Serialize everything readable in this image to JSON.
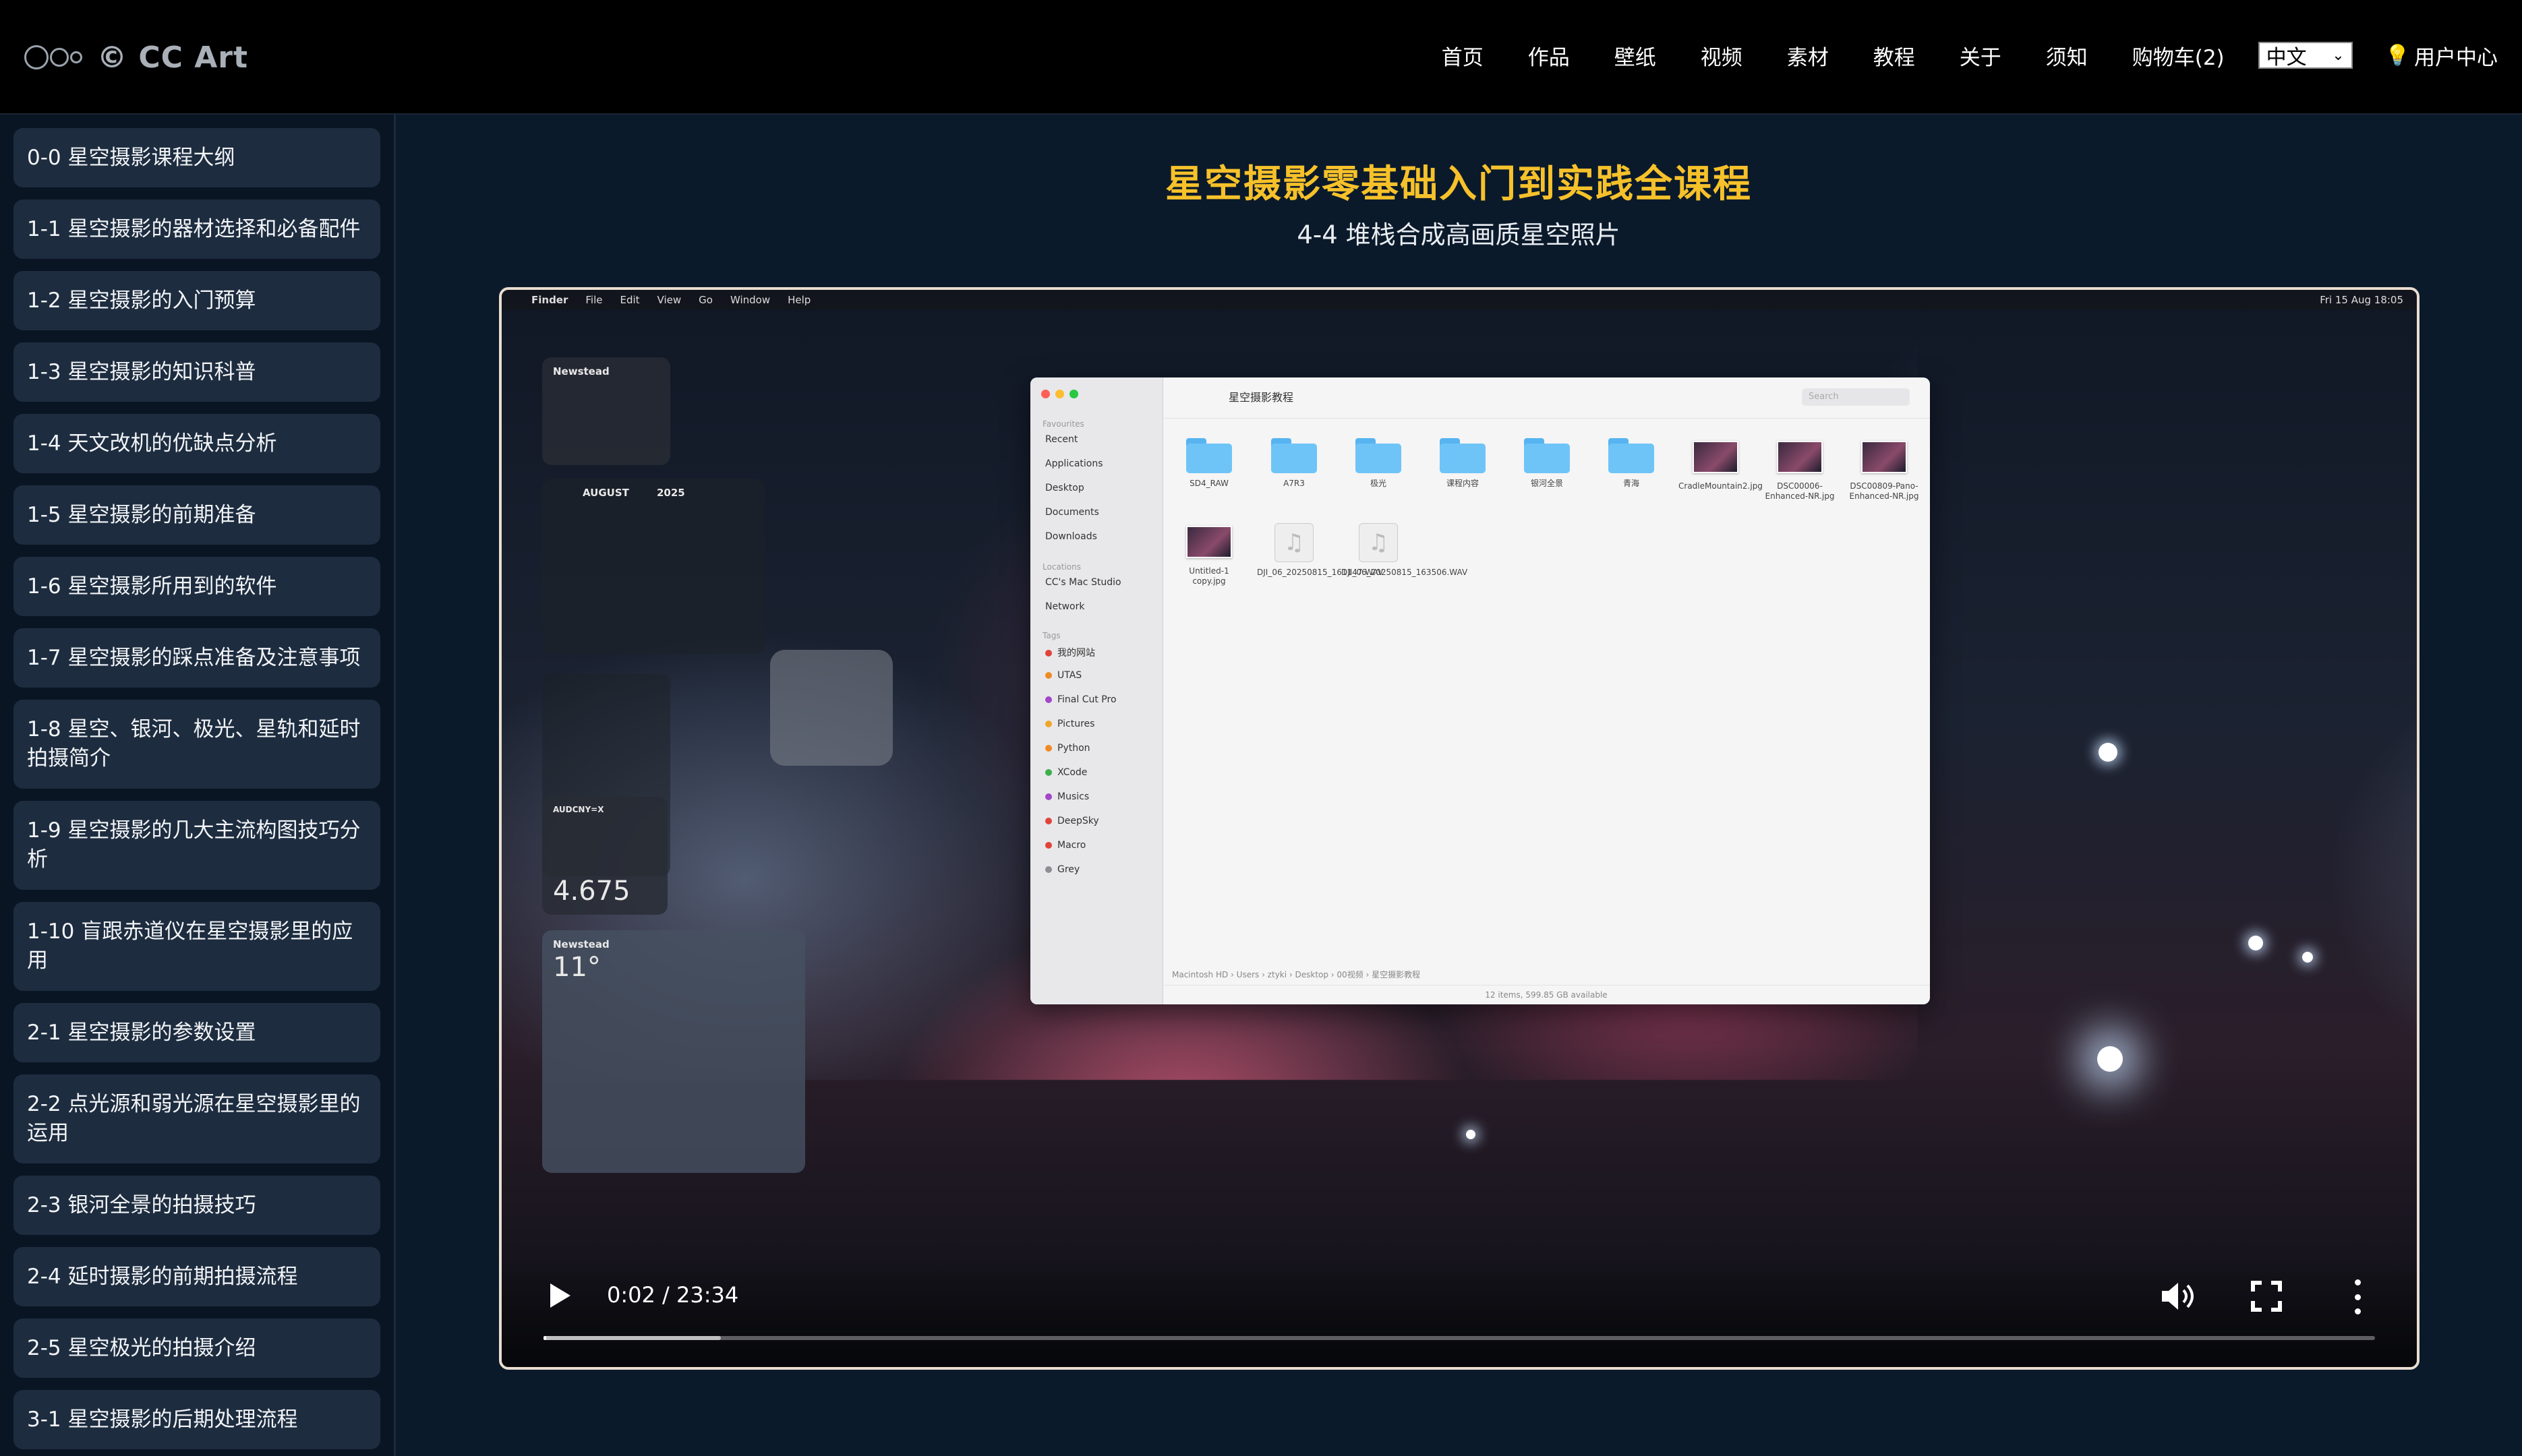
{
  "brand": {
    "name": "© CC Art"
  },
  "nav": {
    "items": [
      "首页",
      "作品",
      "壁纸",
      "视频",
      "素材",
      "教程",
      "关于",
      "须知",
      "购物车(2)"
    ],
    "language": "中文",
    "user_center": "用户中心"
  },
  "sidebar": {
    "lessons": [
      "0-0 星空摄影课程大纲",
      "1-1 星空摄影的器材选择和必备配件",
      "1-2 星空摄影的入门预算",
      "1-3 星空摄影的知识科普",
      "1-4 天文改机的优缺点分析",
      "1-5 星空摄影的前期准备",
      "1-6 星空摄影所用到的软件",
      "1-7 星空摄影的踩点准备及注意事项",
      "1-8 星空、银河、极光、星轨和延时拍摄简介",
      "1-9 星空摄影的几大主流构图技巧分析",
      "1-10 盲跟赤道仪在星空摄影里的应用",
      "2-1 星空摄影的参数设置",
      "2-2 点光源和弱光源在星空摄影里的运用",
      "2-3 银河全景的拍摄技巧",
      "2-4 延时摄影的前期拍摄流程",
      "2-5 星空极光的拍摄介绍",
      "3-1 星空摄影的后期处理流程"
    ]
  },
  "main": {
    "course_title": "星空摄影零基础入门到实践全课程",
    "lesson_title": "4-4 堆栈合成高画质星空照片"
  },
  "video": {
    "current_time": "0:02",
    "duration": "23:34",
    "time_display": "0:02 / 23:34",
    "progress_fraction": 0.0014,
    "buffered_fraction": 0.097,
    "screen": {
      "menubar": [
        "Finder",
        "File",
        "Edit",
        "View",
        "Go",
        "Window",
        "Help"
      ],
      "clock": "Fri 15 Aug 18:05",
      "finder": {
        "title": "星空摄影教程",
        "search_placeholder": "Search",
        "sidebar_headers": [
          "Favourites",
          "Locations",
          "Tags"
        ],
        "favourites": [
          "Recent",
          "Applications",
          "Desktop",
          "Documents",
          "Downloads"
        ],
        "locations": [
          "CC's Mac Studio",
          "Network"
        ],
        "tags": [
          {
            "label": "我的网站",
            "color": "#e0433a"
          },
          {
            "label": "UTAS",
            "color": "#f08a24"
          },
          {
            "label": "Final Cut Pro",
            "color": "#a346c8"
          },
          {
            "label": "Pictures",
            "color": "#f0a52a"
          },
          {
            "label": "Python",
            "color": "#f08a24"
          },
          {
            "label": "XCode",
            "color": "#3cb04b"
          },
          {
            "label": "Musics",
            "color": "#a346c8"
          },
          {
            "label": "DeepSky",
            "color": "#e0433a"
          },
          {
            "label": "Macro",
            "color": "#e0433a"
          },
          {
            "label": "Grey",
            "color": "#8e8e93"
          }
        ],
        "files": [
          {
            "name": "SD4_RAW",
            "kind": "folder"
          },
          {
            "name": "A7R3",
            "kind": "folder"
          },
          {
            "name": "极光",
            "kind": "folder"
          },
          {
            "name": "课程内容",
            "kind": "folder"
          },
          {
            "name": "银河全景",
            "kind": "folder"
          },
          {
            "name": "青海",
            "kind": "folder"
          },
          {
            "name": "CradleMountain2.jpg",
            "kind": "image"
          },
          {
            "name": "DSC00006-Enhanced-NR.jpg",
            "kind": "image"
          },
          {
            "name": "DSC00809-Pano-Enhanced-NR.jpg",
            "kind": "image"
          },
          {
            "name": "Untitled-1 copy.jpg",
            "kind": "image"
          },
          {
            "name": "DJI_06_20250815_161147.WAV",
            "kind": "audio"
          },
          {
            "name": "DJI_06_20250815_163506.WAV",
            "kind": "audio"
          }
        ],
        "path": "Macintosh HD › Users › ztyki › Desktop › 00视频 › 星空摄影教程",
        "status": "12 items, 599.85 GB available"
      },
      "widgets": {
        "weather_city": "Newstead",
        "stock_symbol": "AUDCNY=X",
        "stock_value": "4.675",
        "weather2_city": "Newstead",
        "weather2_temp": "11°",
        "calendar_month": "AUGUST",
        "calendar_year": "2025"
      }
    }
  },
  "colors": {
    "page_bg": "#0b1a2b",
    "topbar_bg": "#000000",
    "lesson_bg": "#1d2c3f",
    "course_title": "#f6c12a",
    "player_border": "#e9ddd0"
  }
}
